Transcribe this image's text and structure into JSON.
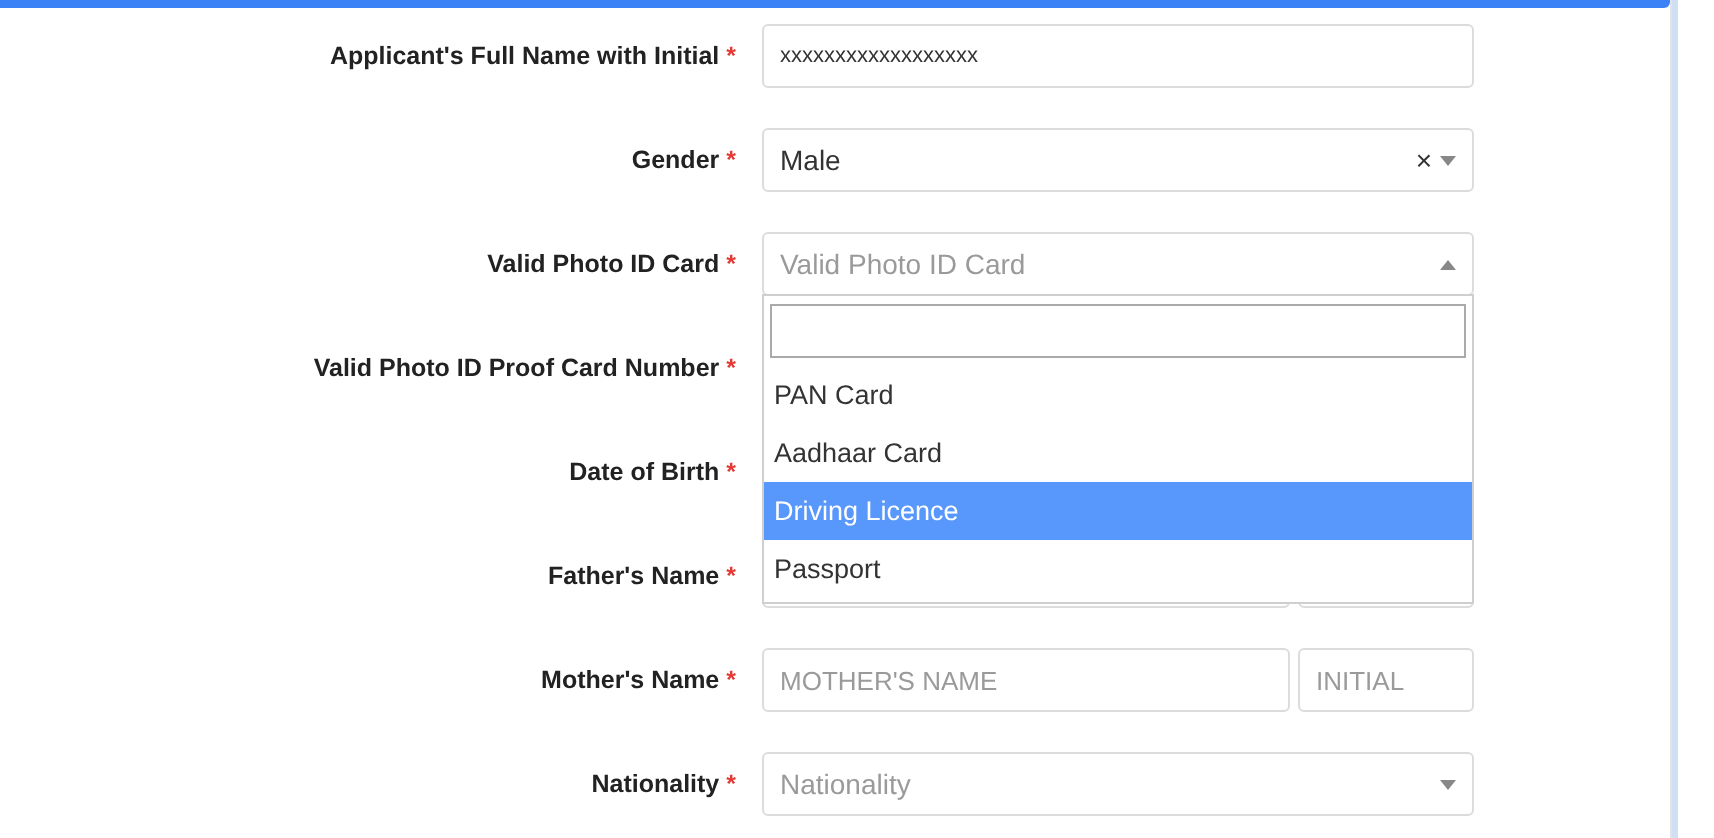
{
  "rows": [
    {
      "label": "Applicant's Full Name with Initial",
      "required_mark": "*",
      "kind": "text",
      "value": "xxxxxxxxxxxxxxxxxx"
    },
    {
      "label": "Gender",
      "required_mark": "*",
      "kind": "select",
      "value": "Male",
      "clear": "×",
      "open": false
    },
    {
      "label": "Valid Photo ID Card",
      "required_mark": "*",
      "kind": "select",
      "placeholder": "Valid Photo ID Card",
      "open": true,
      "options": [
        {
          "label": "PAN Card",
          "selected": false
        },
        {
          "label": "Aadhaar Card",
          "selected": false
        },
        {
          "label": "Driving Licence",
          "selected": true
        },
        {
          "label": "Passport",
          "selected": false
        }
      ]
    },
    {
      "label": "Valid Photo ID Proof Card Number",
      "required_mark": "*",
      "kind": "covered"
    },
    {
      "label": "Date of Birth",
      "required_mark": "*",
      "kind": "covered"
    },
    {
      "label": "Father's Name",
      "required_mark": "*",
      "kind": "split"
    },
    {
      "label": "Mother's Name",
      "required_mark": "*",
      "kind": "split",
      "placeholder": "MOTHER'S NAME",
      "placeholder_2": "INITIAL"
    },
    {
      "label": "Nationality",
      "required_mark": "*",
      "kind": "select",
      "placeholder": "Nationality",
      "open": false
    }
  ]
}
